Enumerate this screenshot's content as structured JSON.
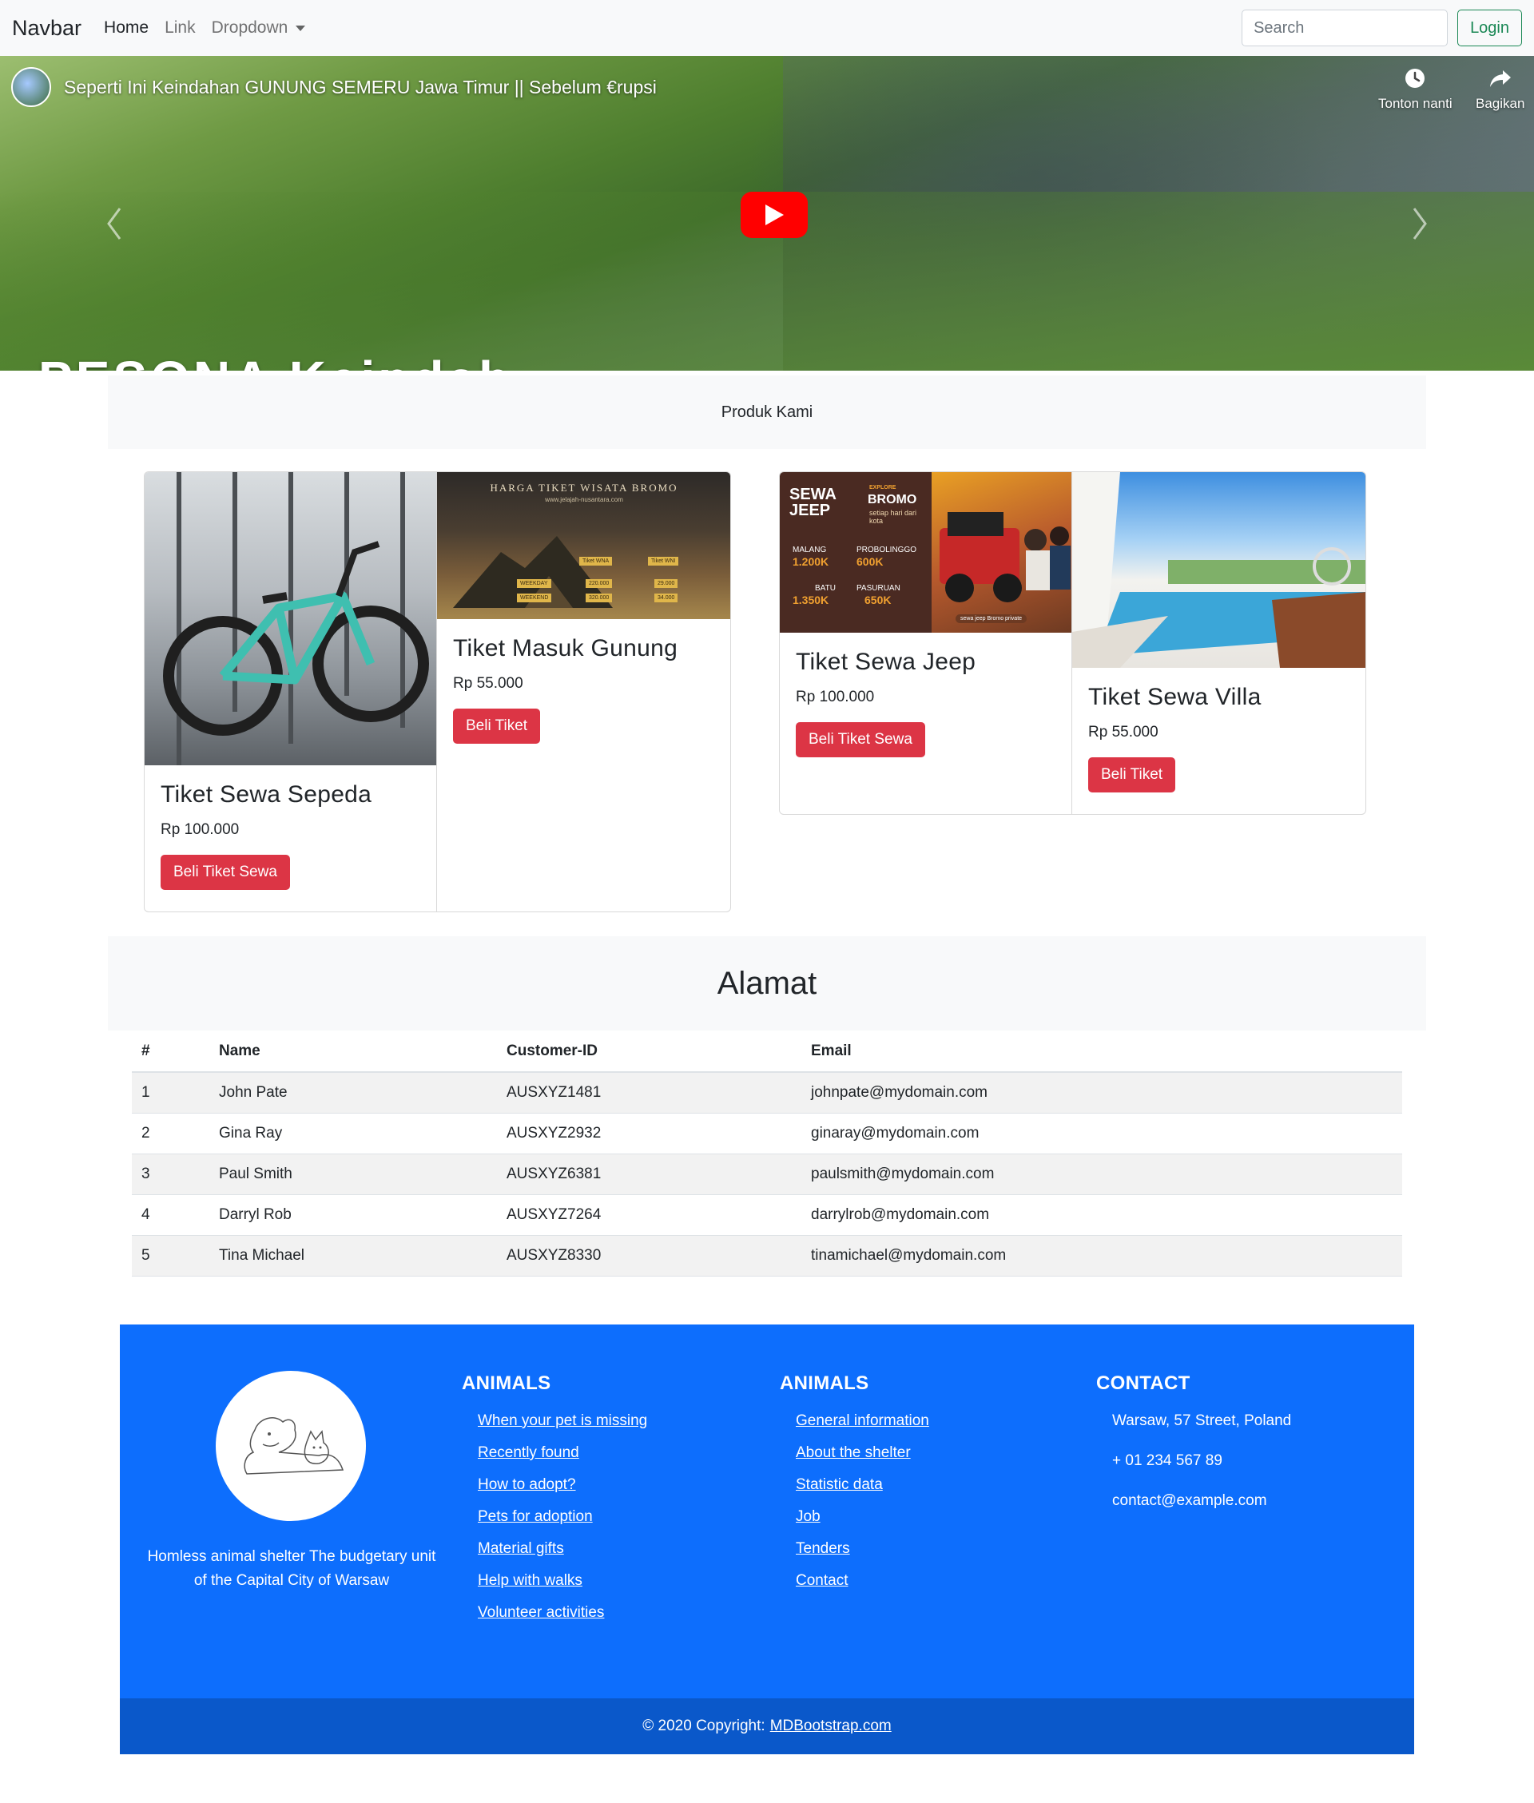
{
  "navbar": {
    "brand": "Navbar",
    "links": [
      "Home",
      "Link",
      "Dropdown"
    ],
    "search_placeholder": "Search",
    "login_label": "Login"
  },
  "hero": {
    "video_title": "Seperti Ini Keindahan GUNUNG SEMERU Jawa Timur || Sebelum €rupsi",
    "watch_later": "Tonton nanti",
    "share": "Bagikan",
    "watermark": "PESONA Keindah"
  },
  "produk": {
    "heading": "Produk Kami",
    "groups": [
      {
        "cards": [
          {
            "title": "Tiket Sewa Sepeda",
            "price": "Rp 100.000",
            "button": "Beli Tiket Sewa"
          },
          {
            "title": "Tiket Masuk Gunung",
            "price": "Rp 55.000",
            "button": "Beli Tiket"
          }
        ]
      },
      {
        "cards": [
          {
            "title": "Tiket Sewa Jeep",
            "price": "Rp 100.000",
            "button": "Beli Tiket Sewa"
          },
          {
            "title": "Tiket Sewa Villa",
            "price": "Rp 55.000",
            "button": "Beli Tiket"
          }
        ]
      }
    ],
    "bromo_image_text": {
      "title": "HARGA TIKET WISATA BROMO",
      "site": "www.jelajah-nusantara.com",
      "col1": "Tiket WNA",
      "col2": "Tiket WNI",
      "row1": "WEEKDAY",
      "row2": "WEEKEND",
      "wna_weekday": "220.000",
      "wna_weekend": "320.000",
      "wni_weekday": "29.000",
      "wni_weekend": "34.000"
    },
    "jeep_image_text": {
      "heading": "SEWA JEEP",
      "explore": "EXPLORE",
      "bromo": "BROMO",
      "sub": "setiap hari dari kota",
      "malang": "MALANG",
      "malang_price": "1.200K",
      "probolinggo": "PROBOLINGGO",
      "probolinggo_price": "600K",
      "batu": "BATU",
      "batu_price": "1.350K",
      "pasuruan": "PASURUAN",
      "pasuruan_price": "650K",
      "footer": "sewa jeep Bromo private"
    }
  },
  "alamat": {
    "heading": "Alamat",
    "columns": [
      "#",
      "Name",
      "Customer-ID",
      "Email"
    ],
    "rows": [
      [
        "1",
        "John Pate",
        "AUSXYZ1481",
        "johnpate@mydomain.com"
      ],
      [
        "2",
        "Gina Ray",
        "AUSXYZ2932",
        "ginaray@mydomain.com"
      ],
      [
        "3",
        "Paul Smith",
        "AUSXYZ6381",
        "paulsmith@mydomain.com"
      ],
      [
        "4",
        "Darryl Rob",
        "AUSXYZ7264",
        "darrylrob@mydomain.com"
      ],
      [
        "5",
        "Tina Michael",
        "AUSXYZ8330",
        "tinamichael@mydomain.com"
      ]
    ]
  },
  "footer": {
    "about": "Homless animal shelter The budgetary unit of the Capital City of Warsaw",
    "col1_title": "ANIMALS",
    "col1_links": [
      "When your pet is missing",
      "Recently found",
      "How to adopt?",
      "Pets for adoption",
      "Material gifts",
      "Help with walks",
      "Volunteer activities"
    ],
    "col2_title": "ANIMALS",
    "col2_links": [
      "General information",
      "About the shelter",
      "Statistic data",
      "Job",
      "Tenders",
      "Contact"
    ],
    "contact_title": "CONTACT",
    "contact_items": [
      "Warsaw, 57 Street, Poland",
      "+ 01 234 567 89",
      "contact@example.com"
    ],
    "copyright": "© 2020 Copyright:",
    "copyright_link": "MDBootstrap.com"
  },
  "colors": {
    "navbar_bg": "#f8f9fa",
    "primary": "#0d6efd",
    "danger": "#dc3545",
    "success": "#198754",
    "youtube_red": "#ff0000"
  }
}
